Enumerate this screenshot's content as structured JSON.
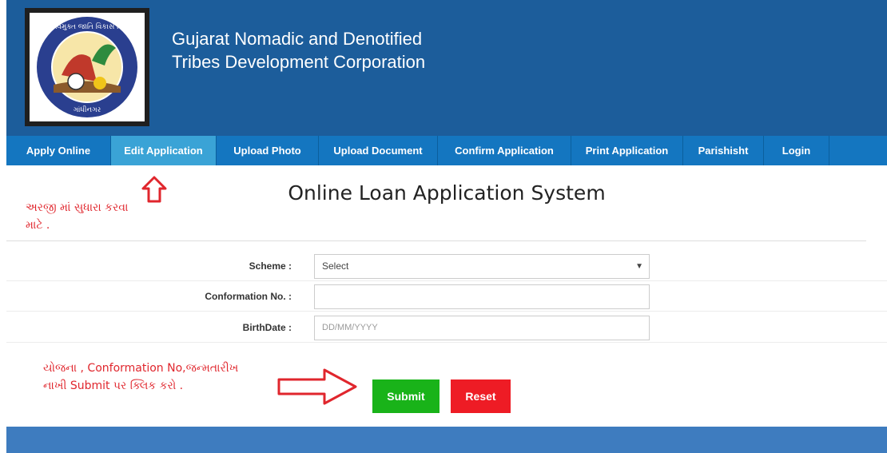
{
  "header": {
    "title_line1": "Gujarat Nomadic and Denotified",
    "title_line2": "Tribes Development Corporation",
    "logo_text_top": "અને વિમુક્ત જાતિ વિકાસ નિગમ",
    "logo_text_bottom": "ગાંધીનગર"
  },
  "nav": {
    "items": [
      {
        "label": "Apply Online"
      },
      {
        "label": "Edit Application"
      },
      {
        "label": "Upload Photo"
      },
      {
        "label": "Upload Document"
      },
      {
        "label": "Confirm Application"
      },
      {
        "label": "Print Application"
      },
      {
        "label": "Parishisht"
      },
      {
        "label": "Login"
      }
    ],
    "active_item": "Edit Application"
  },
  "page": {
    "heading": "Online Loan Application System"
  },
  "form": {
    "scheme_label": "Scheme :",
    "scheme_value": "Select",
    "confirmation_label": "Conformation No. :",
    "confirmation_value": "",
    "birthdate_label": "BirthDate :",
    "birthdate_placeholder": "DD/MM/YYYY",
    "submit_label": "Submit",
    "reset_label": "Reset"
  },
  "annotations": {
    "edit_note_line1": "અરજી માં સુધારા કરવા",
    "edit_note_line2": "માટે .",
    "submit_note_line1": "યોજના , Conformation No,જન્મતારીખ",
    "submit_note_line2": "નાખી Submit પર ક્લિક કરો ."
  },
  "colors": {
    "header_bg": "#1c5d9b",
    "nav_bg": "#1476c0",
    "nav_active": "#3aa3d6",
    "submit": "#19b319",
    "reset": "#ee1c25",
    "annotation": "#e0262d"
  }
}
